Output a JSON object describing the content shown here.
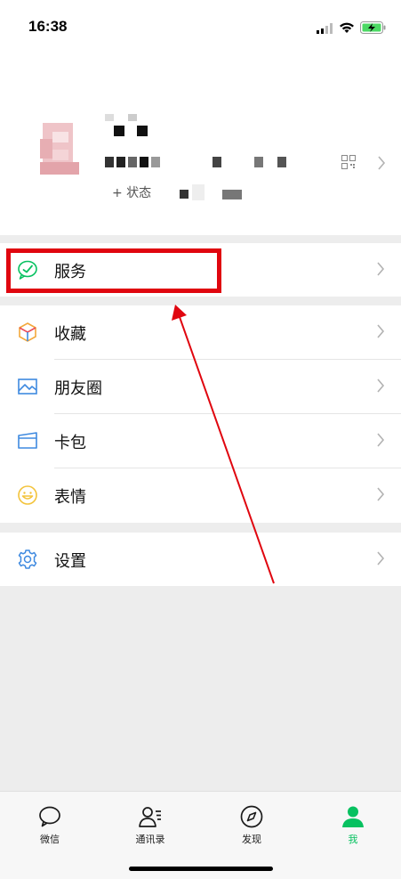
{
  "status_bar": {
    "time": "16:38"
  },
  "profile": {
    "add_status_label": "+ 状态"
  },
  "menu": {
    "services": "服务",
    "favorites": "收藏",
    "moments": "朋友圈",
    "cards": "卡包",
    "stickers": "表情",
    "settings": "设置"
  },
  "tabbar": {
    "chats": "微信",
    "contacts": "通讯录",
    "discover": "发现",
    "me": "我"
  },
  "colors": {
    "accent_green": "#07c160",
    "highlight_red": "#e0060f",
    "background": "#ededed"
  },
  "icons": [
    "signal-icon",
    "wifi-icon",
    "battery-icon",
    "qrcode-icon",
    "services-icon",
    "favorites-icon",
    "moments-icon",
    "cards-icon",
    "stickers-icon",
    "settings-icon",
    "chat-bubble-icon",
    "contacts-icon",
    "discover-compass-icon",
    "me-person-icon"
  ]
}
